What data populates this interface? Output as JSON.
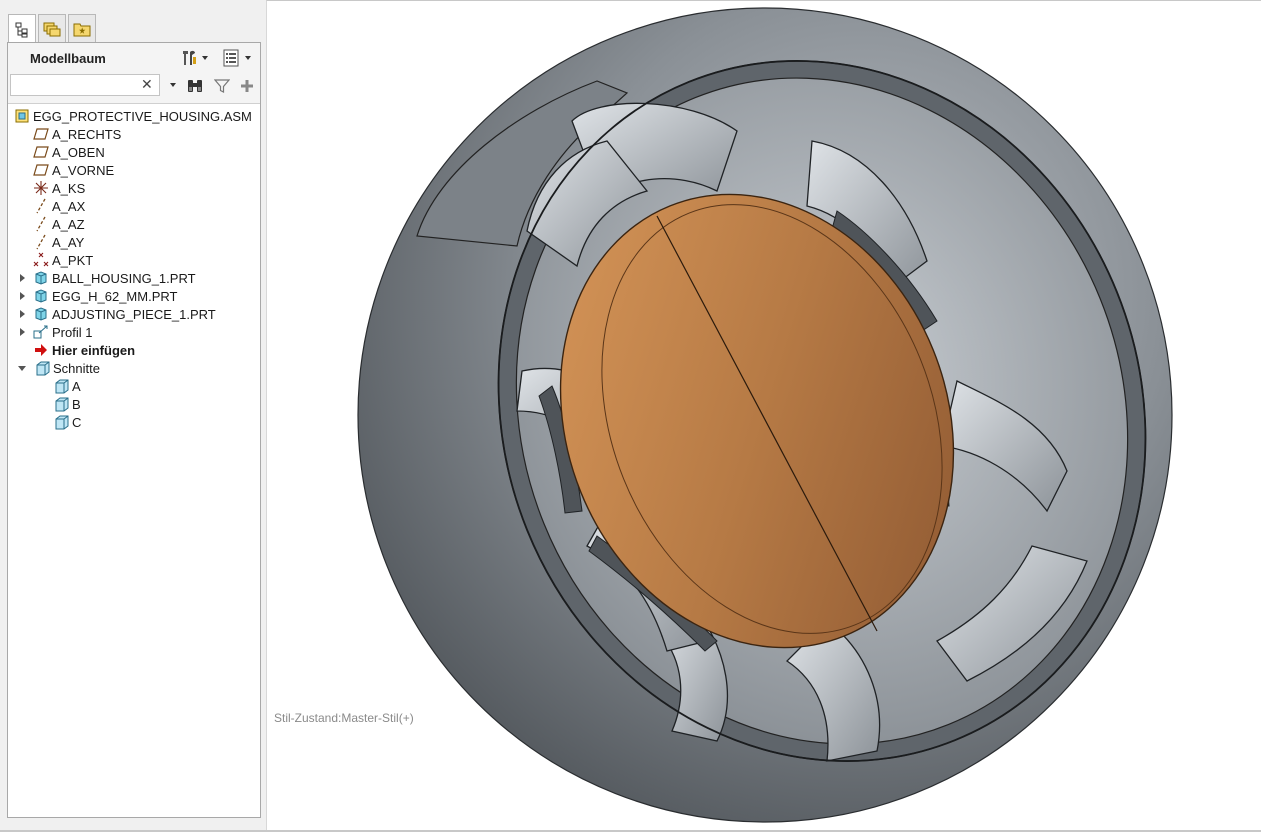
{
  "model_tree": {
    "title": "Modellbaum",
    "search": {
      "value": "",
      "placeholder": ""
    },
    "items": [
      {
        "label": "EGG_PROTECTIVE_HOUSING.ASM",
        "icon": "assembly-icon"
      },
      {
        "label": "A_RECHTS",
        "icon": "datum-plane-icon"
      },
      {
        "label": "A_OBEN",
        "icon": "datum-plane-icon"
      },
      {
        "label": "A_VORNE",
        "icon": "datum-plane-icon"
      },
      {
        "label": "A_KS",
        "icon": "coordinate-system-icon"
      },
      {
        "label": "A_AX",
        "icon": "datum-axis-icon"
      },
      {
        "label": "A_AZ",
        "icon": "datum-axis-icon"
      },
      {
        "label": "A_AY",
        "icon": "datum-axis-icon"
      },
      {
        "label": "A_PKT",
        "icon": "datum-point-icon"
      },
      {
        "label": "BALL_HOUSING_1.PRT",
        "icon": "part-icon"
      },
      {
        "label": "EGG_H_62_MM.PRT",
        "icon": "part-icon"
      },
      {
        "label": "ADJUSTING_PIECE_1.PRT",
        "icon": "part-icon"
      },
      {
        "label": "Profil 1",
        "icon": "profile-icon"
      },
      {
        "label": "Hier einfügen",
        "icon": "insert-here-icon"
      },
      {
        "label": "Schnitte",
        "icon": "sections-folder-icon"
      },
      {
        "label": "A",
        "icon": "section-icon"
      },
      {
        "label": "B",
        "icon": "section-icon"
      },
      {
        "label": "C",
        "icon": "section-icon"
      }
    ]
  },
  "viewport": {
    "status_text": "Stil-Zustand:Master-Stil(+)"
  },
  "colors": {
    "housing": "#6b7076",
    "egg": "#b67a45",
    "insert_red": "#d01010"
  }
}
